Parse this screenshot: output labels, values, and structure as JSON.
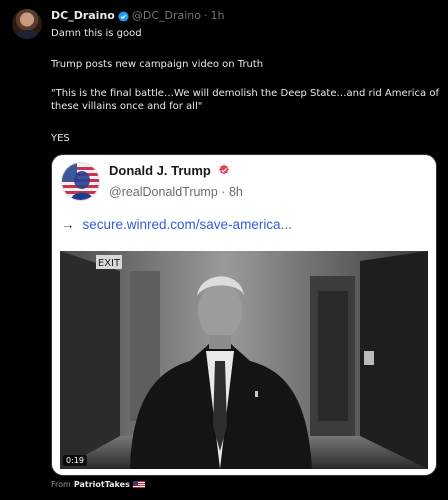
{
  "post": {
    "display_name": "DC_Draino",
    "handle": "@DC_Draino",
    "separator": "·",
    "time": "1h",
    "lines": [
      "Damn this is good",
      "Trump posts new campaign video on Truth",
      "\"This is the final battle…We will demolish the Deep State…and rid America of these villains once and for all\"",
      "YES"
    ]
  },
  "quoted": {
    "name": "Donald J. Trump",
    "handle": "@realDonaldTrump",
    "separator": "·",
    "time": "8h",
    "arrow": "→",
    "link": "secure.winred.com/save-america...",
    "video_duration": "0:19",
    "exit_sign": "EXIT"
  },
  "source": {
    "from_label": "From",
    "name": "PatriotTakes"
  },
  "colors": {
    "background": "#000000",
    "verified": "#1d9bf0",
    "truth_badge": "#e0405a",
    "link": "#2f5fd8"
  }
}
